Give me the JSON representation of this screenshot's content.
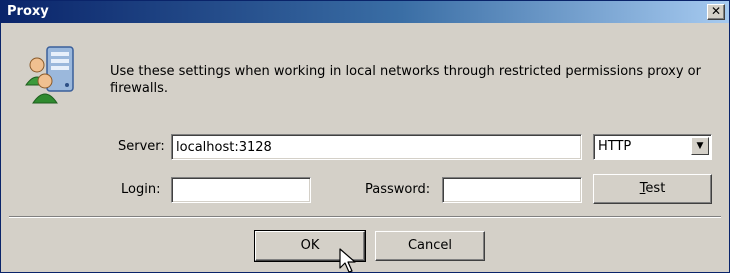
{
  "window": {
    "title": "Proxy"
  },
  "icons": {
    "close": "close-icon",
    "network": "network-users-server-icon",
    "cursor": "mouse-pointer-icon"
  },
  "description": "Use these settings when working in local networks through restricted permissions proxy or firewalls.",
  "server": {
    "label": "Server:",
    "value": "localhost:3128"
  },
  "protocol": {
    "selected": "HTTP"
  },
  "login": {
    "label": "Login:",
    "value": ""
  },
  "password": {
    "label": "Password:",
    "value": ""
  },
  "buttons": {
    "test_prefix": "",
    "test_underlined": "T",
    "test_suffix": "est",
    "ok": "OK",
    "cancel": "Cancel"
  },
  "colors": {
    "titlebar_start": "#0a246a",
    "titlebar_end": "#a6caf0",
    "dialog_bg": "#d4d0c8"
  }
}
